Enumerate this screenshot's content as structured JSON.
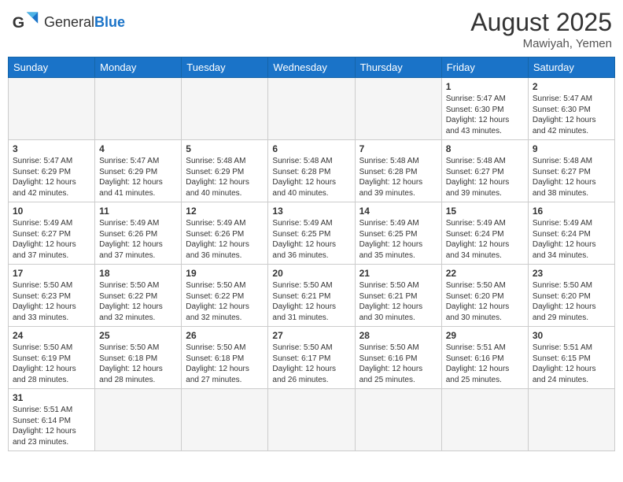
{
  "header": {
    "logo_general": "General",
    "logo_blue": "Blue",
    "month_year": "August 2025",
    "location": "Mawiyah, Yemen"
  },
  "days_of_week": [
    "Sunday",
    "Monday",
    "Tuesday",
    "Wednesday",
    "Thursday",
    "Friday",
    "Saturday"
  ],
  "weeks": [
    [
      {
        "day": "",
        "info": ""
      },
      {
        "day": "",
        "info": ""
      },
      {
        "day": "",
        "info": ""
      },
      {
        "day": "",
        "info": ""
      },
      {
        "day": "",
        "info": ""
      },
      {
        "day": "1",
        "info": "Sunrise: 5:47 AM\nSunset: 6:30 PM\nDaylight: 12 hours and 43 minutes."
      },
      {
        "day": "2",
        "info": "Sunrise: 5:47 AM\nSunset: 6:30 PM\nDaylight: 12 hours and 42 minutes."
      }
    ],
    [
      {
        "day": "3",
        "info": "Sunrise: 5:47 AM\nSunset: 6:29 PM\nDaylight: 12 hours and 42 minutes."
      },
      {
        "day": "4",
        "info": "Sunrise: 5:47 AM\nSunset: 6:29 PM\nDaylight: 12 hours and 41 minutes."
      },
      {
        "day": "5",
        "info": "Sunrise: 5:48 AM\nSunset: 6:29 PM\nDaylight: 12 hours and 40 minutes."
      },
      {
        "day": "6",
        "info": "Sunrise: 5:48 AM\nSunset: 6:28 PM\nDaylight: 12 hours and 40 minutes."
      },
      {
        "day": "7",
        "info": "Sunrise: 5:48 AM\nSunset: 6:28 PM\nDaylight: 12 hours and 39 minutes."
      },
      {
        "day": "8",
        "info": "Sunrise: 5:48 AM\nSunset: 6:27 PM\nDaylight: 12 hours and 39 minutes."
      },
      {
        "day": "9",
        "info": "Sunrise: 5:48 AM\nSunset: 6:27 PM\nDaylight: 12 hours and 38 minutes."
      }
    ],
    [
      {
        "day": "10",
        "info": "Sunrise: 5:49 AM\nSunset: 6:27 PM\nDaylight: 12 hours and 37 minutes."
      },
      {
        "day": "11",
        "info": "Sunrise: 5:49 AM\nSunset: 6:26 PM\nDaylight: 12 hours and 37 minutes."
      },
      {
        "day": "12",
        "info": "Sunrise: 5:49 AM\nSunset: 6:26 PM\nDaylight: 12 hours and 36 minutes."
      },
      {
        "day": "13",
        "info": "Sunrise: 5:49 AM\nSunset: 6:25 PM\nDaylight: 12 hours and 36 minutes."
      },
      {
        "day": "14",
        "info": "Sunrise: 5:49 AM\nSunset: 6:25 PM\nDaylight: 12 hours and 35 minutes."
      },
      {
        "day": "15",
        "info": "Sunrise: 5:49 AM\nSunset: 6:24 PM\nDaylight: 12 hours and 34 minutes."
      },
      {
        "day": "16",
        "info": "Sunrise: 5:49 AM\nSunset: 6:24 PM\nDaylight: 12 hours and 34 minutes."
      }
    ],
    [
      {
        "day": "17",
        "info": "Sunrise: 5:50 AM\nSunset: 6:23 PM\nDaylight: 12 hours and 33 minutes."
      },
      {
        "day": "18",
        "info": "Sunrise: 5:50 AM\nSunset: 6:22 PM\nDaylight: 12 hours and 32 minutes."
      },
      {
        "day": "19",
        "info": "Sunrise: 5:50 AM\nSunset: 6:22 PM\nDaylight: 12 hours and 32 minutes."
      },
      {
        "day": "20",
        "info": "Sunrise: 5:50 AM\nSunset: 6:21 PM\nDaylight: 12 hours and 31 minutes."
      },
      {
        "day": "21",
        "info": "Sunrise: 5:50 AM\nSunset: 6:21 PM\nDaylight: 12 hours and 30 minutes."
      },
      {
        "day": "22",
        "info": "Sunrise: 5:50 AM\nSunset: 6:20 PM\nDaylight: 12 hours and 30 minutes."
      },
      {
        "day": "23",
        "info": "Sunrise: 5:50 AM\nSunset: 6:20 PM\nDaylight: 12 hours and 29 minutes."
      }
    ],
    [
      {
        "day": "24",
        "info": "Sunrise: 5:50 AM\nSunset: 6:19 PM\nDaylight: 12 hours and 28 minutes."
      },
      {
        "day": "25",
        "info": "Sunrise: 5:50 AM\nSunset: 6:18 PM\nDaylight: 12 hours and 28 minutes."
      },
      {
        "day": "26",
        "info": "Sunrise: 5:50 AM\nSunset: 6:18 PM\nDaylight: 12 hours and 27 minutes."
      },
      {
        "day": "27",
        "info": "Sunrise: 5:50 AM\nSunset: 6:17 PM\nDaylight: 12 hours and 26 minutes."
      },
      {
        "day": "28",
        "info": "Sunrise: 5:50 AM\nSunset: 6:16 PM\nDaylight: 12 hours and 25 minutes."
      },
      {
        "day": "29",
        "info": "Sunrise: 5:51 AM\nSunset: 6:16 PM\nDaylight: 12 hours and 25 minutes."
      },
      {
        "day": "30",
        "info": "Sunrise: 5:51 AM\nSunset: 6:15 PM\nDaylight: 12 hours and 24 minutes."
      }
    ],
    [
      {
        "day": "31",
        "info": "Sunrise: 5:51 AM\nSunset: 6:14 PM\nDaylight: 12 hours and 23 minutes."
      },
      {
        "day": "",
        "info": ""
      },
      {
        "day": "",
        "info": ""
      },
      {
        "day": "",
        "info": ""
      },
      {
        "day": "",
        "info": ""
      },
      {
        "day": "",
        "info": ""
      },
      {
        "day": "",
        "info": ""
      }
    ]
  ]
}
